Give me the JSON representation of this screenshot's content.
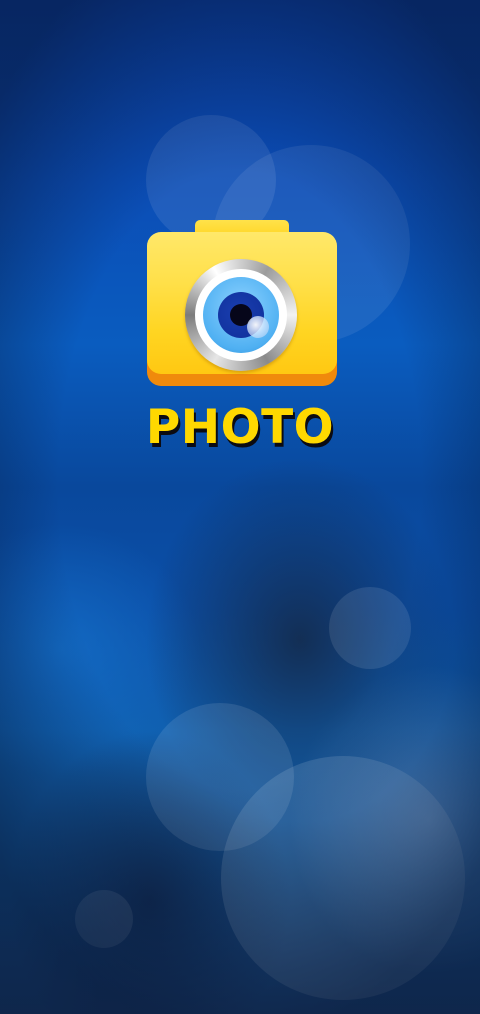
{
  "splash": {
    "app_name": "PHOTO",
    "logo_icon": "camera-icon",
    "colors": {
      "background": "#0b4db6",
      "logo_yellow": "#ffd800",
      "logo_orange": "#f08a0c",
      "lens_blue": "#1233a0"
    }
  }
}
